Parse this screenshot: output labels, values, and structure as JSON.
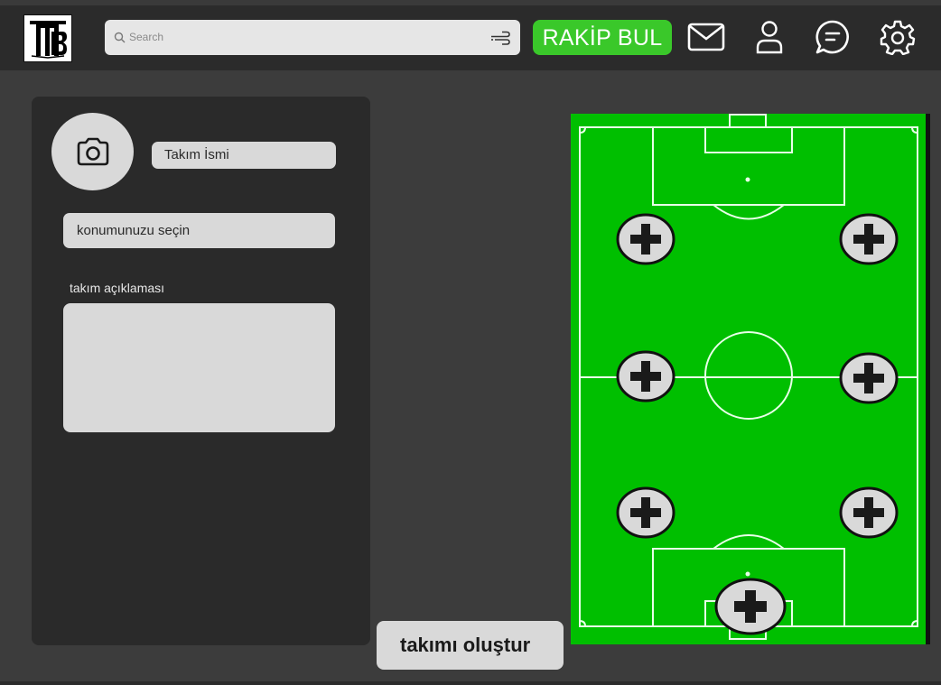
{
  "header": {
    "logo_text": "MB",
    "search": {
      "placeholder": "Search"
    },
    "find_opponent_label": "RAKİP BUL",
    "icons": [
      "mail-icon",
      "user-icon",
      "chat-icon",
      "settings-icon"
    ]
  },
  "team_form": {
    "photo_icon": "camera-icon",
    "team_name_placeholder": "Takım İsmi",
    "location_placeholder": "konumunuzu seçin",
    "description_label": "takım açıklaması",
    "description_value": ""
  },
  "submit_label": "takımı oluştur",
  "pitch": {
    "slot_icon": "plus-icon",
    "slot_count": 7
  },
  "colors": {
    "background": "#3c3c3c",
    "header": "#2b2b2b",
    "panel": "#2a2a2a",
    "accent_green": "#3ac82a",
    "pitch_green": "#00bf00",
    "input_bg": "#d9d9d9"
  }
}
